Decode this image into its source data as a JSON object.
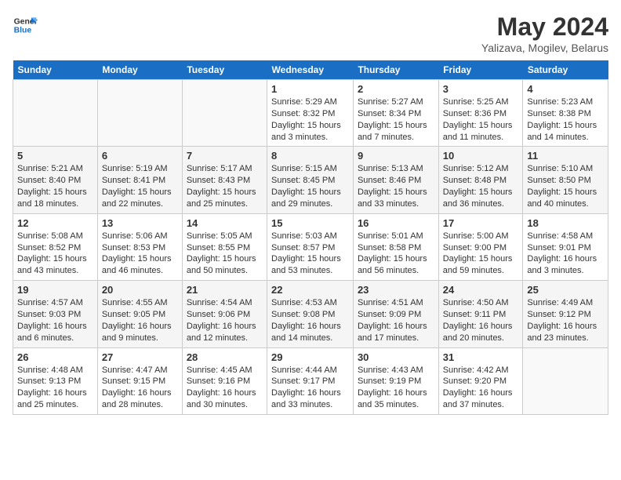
{
  "header": {
    "logo_line1": "General",
    "logo_line2": "Blue",
    "month": "May 2024",
    "location": "Yalizava, Mogilev, Belarus"
  },
  "weekdays": [
    "Sunday",
    "Monday",
    "Tuesday",
    "Wednesday",
    "Thursday",
    "Friday",
    "Saturday"
  ],
  "weeks": [
    [
      {
        "day": "",
        "info": ""
      },
      {
        "day": "",
        "info": ""
      },
      {
        "day": "",
        "info": ""
      },
      {
        "day": "1",
        "info": "Sunrise: 5:29 AM\nSunset: 8:32 PM\nDaylight: 15 hours and 3 minutes."
      },
      {
        "day": "2",
        "info": "Sunrise: 5:27 AM\nSunset: 8:34 PM\nDaylight: 15 hours and 7 minutes."
      },
      {
        "day": "3",
        "info": "Sunrise: 5:25 AM\nSunset: 8:36 PM\nDaylight: 15 hours and 11 minutes."
      },
      {
        "day": "4",
        "info": "Sunrise: 5:23 AM\nSunset: 8:38 PM\nDaylight: 15 hours and 14 minutes."
      }
    ],
    [
      {
        "day": "5",
        "info": "Sunrise: 5:21 AM\nSunset: 8:40 PM\nDaylight: 15 hours and 18 minutes."
      },
      {
        "day": "6",
        "info": "Sunrise: 5:19 AM\nSunset: 8:41 PM\nDaylight: 15 hours and 22 minutes."
      },
      {
        "day": "7",
        "info": "Sunrise: 5:17 AM\nSunset: 8:43 PM\nDaylight: 15 hours and 25 minutes."
      },
      {
        "day": "8",
        "info": "Sunrise: 5:15 AM\nSunset: 8:45 PM\nDaylight: 15 hours and 29 minutes."
      },
      {
        "day": "9",
        "info": "Sunrise: 5:13 AM\nSunset: 8:46 PM\nDaylight: 15 hours and 33 minutes."
      },
      {
        "day": "10",
        "info": "Sunrise: 5:12 AM\nSunset: 8:48 PM\nDaylight: 15 hours and 36 minutes."
      },
      {
        "day": "11",
        "info": "Sunrise: 5:10 AM\nSunset: 8:50 PM\nDaylight: 15 hours and 40 minutes."
      }
    ],
    [
      {
        "day": "12",
        "info": "Sunrise: 5:08 AM\nSunset: 8:52 PM\nDaylight: 15 hours and 43 minutes."
      },
      {
        "day": "13",
        "info": "Sunrise: 5:06 AM\nSunset: 8:53 PM\nDaylight: 15 hours and 46 minutes."
      },
      {
        "day": "14",
        "info": "Sunrise: 5:05 AM\nSunset: 8:55 PM\nDaylight: 15 hours and 50 minutes."
      },
      {
        "day": "15",
        "info": "Sunrise: 5:03 AM\nSunset: 8:57 PM\nDaylight: 15 hours and 53 minutes."
      },
      {
        "day": "16",
        "info": "Sunrise: 5:01 AM\nSunset: 8:58 PM\nDaylight: 15 hours and 56 minutes."
      },
      {
        "day": "17",
        "info": "Sunrise: 5:00 AM\nSunset: 9:00 PM\nDaylight: 15 hours and 59 minutes."
      },
      {
        "day": "18",
        "info": "Sunrise: 4:58 AM\nSunset: 9:01 PM\nDaylight: 16 hours and 3 minutes."
      }
    ],
    [
      {
        "day": "19",
        "info": "Sunrise: 4:57 AM\nSunset: 9:03 PM\nDaylight: 16 hours and 6 minutes."
      },
      {
        "day": "20",
        "info": "Sunrise: 4:55 AM\nSunset: 9:05 PM\nDaylight: 16 hours and 9 minutes."
      },
      {
        "day": "21",
        "info": "Sunrise: 4:54 AM\nSunset: 9:06 PM\nDaylight: 16 hours and 12 minutes."
      },
      {
        "day": "22",
        "info": "Sunrise: 4:53 AM\nSunset: 9:08 PM\nDaylight: 16 hours and 14 minutes."
      },
      {
        "day": "23",
        "info": "Sunrise: 4:51 AM\nSunset: 9:09 PM\nDaylight: 16 hours and 17 minutes."
      },
      {
        "day": "24",
        "info": "Sunrise: 4:50 AM\nSunset: 9:11 PM\nDaylight: 16 hours and 20 minutes."
      },
      {
        "day": "25",
        "info": "Sunrise: 4:49 AM\nSunset: 9:12 PM\nDaylight: 16 hours and 23 minutes."
      }
    ],
    [
      {
        "day": "26",
        "info": "Sunrise: 4:48 AM\nSunset: 9:13 PM\nDaylight: 16 hours and 25 minutes."
      },
      {
        "day": "27",
        "info": "Sunrise: 4:47 AM\nSunset: 9:15 PM\nDaylight: 16 hours and 28 minutes."
      },
      {
        "day": "28",
        "info": "Sunrise: 4:45 AM\nSunset: 9:16 PM\nDaylight: 16 hours and 30 minutes."
      },
      {
        "day": "29",
        "info": "Sunrise: 4:44 AM\nSunset: 9:17 PM\nDaylight: 16 hours and 33 minutes."
      },
      {
        "day": "30",
        "info": "Sunrise: 4:43 AM\nSunset: 9:19 PM\nDaylight: 16 hours and 35 minutes."
      },
      {
        "day": "31",
        "info": "Sunrise: 4:42 AM\nSunset: 9:20 PM\nDaylight: 16 hours and 37 minutes."
      },
      {
        "day": "",
        "info": ""
      }
    ]
  ]
}
